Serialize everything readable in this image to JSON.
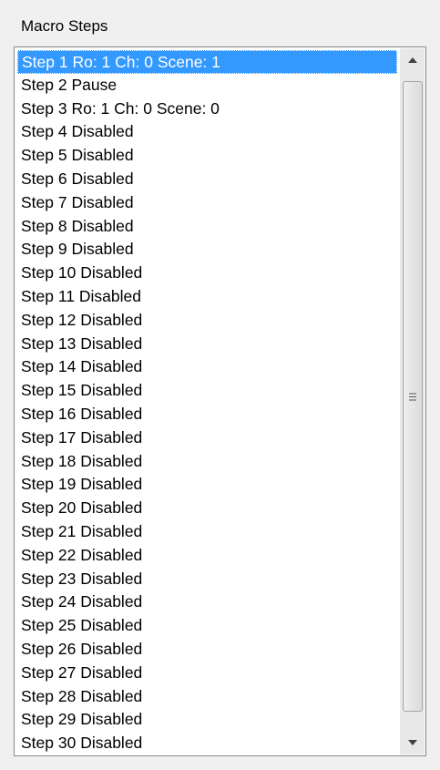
{
  "panel": {
    "title": "Macro Steps"
  },
  "list": {
    "selected_index": 0,
    "items": [
      "Step  1  Ro: 1 Ch: 0 Scene: 1",
      "Step  2  Pause",
      "Step  3  Ro: 1 Ch: 0 Scene: 0",
      "Step  4 Disabled",
      "Step  5 Disabled",
      "Step  6 Disabled",
      "Step  7 Disabled",
      "Step  8 Disabled",
      "Step  9 Disabled",
      "Step  10 Disabled",
      "Step  11 Disabled",
      "Step  12 Disabled",
      "Step  13 Disabled",
      "Step  14 Disabled",
      "Step  15 Disabled",
      "Step  16 Disabled",
      "Step  17 Disabled",
      "Step  18 Disabled",
      "Step  19 Disabled",
      "Step  20 Disabled",
      "Step  21 Disabled",
      "Step  22 Disabled",
      "Step  23 Disabled",
      "Step  24 Disabled",
      "Step  25 Disabled",
      "Step  26 Disabled",
      "Step  27 Disabled",
      "Step  28 Disabled",
      "Step  29 Disabled",
      "Step  30 Disabled"
    ]
  },
  "scrollbar": {
    "up_icon": "arrow-up-icon",
    "down_icon": "arrow-down-icon",
    "grip_icon": "grip-icon"
  },
  "colors": {
    "selection": "#3399ff",
    "selection_text": "#ffffff",
    "background": "#f0f0f0"
  }
}
